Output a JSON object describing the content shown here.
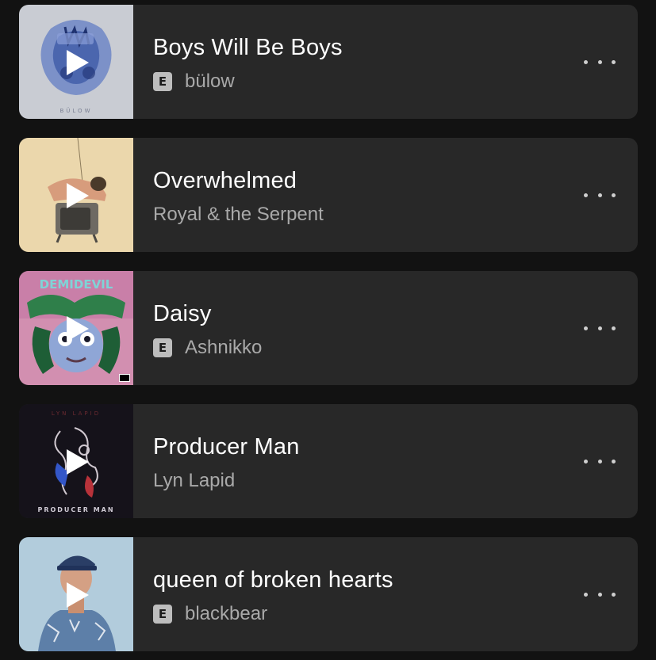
{
  "tracks": [
    {
      "title": "Boys Will Be Boys",
      "artist": "bülow",
      "explicit": true,
      "explicit_label": "E",
      "cover_text": "BÜLOW",
      "cover_icon": "play-icon",
      "more_icon": "more-options-icon"
    },
    {
      "title": "Overwhelmed",
      "artist": "Royal & the Serpent",
      "explicit": false,
      "cover_icon": "play-icon",
      "more_icon": "more-options-icon"
    },
    {
      "title": "Daisy",
      "artist": "Ashnikko",
      "explicit": true,
      "explicit_label": "E",
      "cover_text": "DEMIDEVIL",
      "cover_icon": "play-icon",
      "more_icon": "more-options-icon"
    },
    {
      "title": "Producer Man",
      "artist": "Lyn Lapid",
      "explicit": false,
      "cover_text": "PRODUCER MAN",
      "cover_text_top": "LYN LAPID",
      "cover_icon": "play-icon",
      "more_icon": "more-options-icon"
    },
    {
      "title": "queen of broken hearts",
      "artist": "blackbear",
      "explicit": true,
      "explicit_label": "E",
      "cover_icon": "play-icon",
      "more_icon": "more-options-icon"
    }
  ],
  "colors": {
    "background": "#121212",
    "card": "#282828",
    "title": "#ffffff",
    "artist": "#a9a9a9",
    "explicit_badge": "#bdbdbd"
  }
}
